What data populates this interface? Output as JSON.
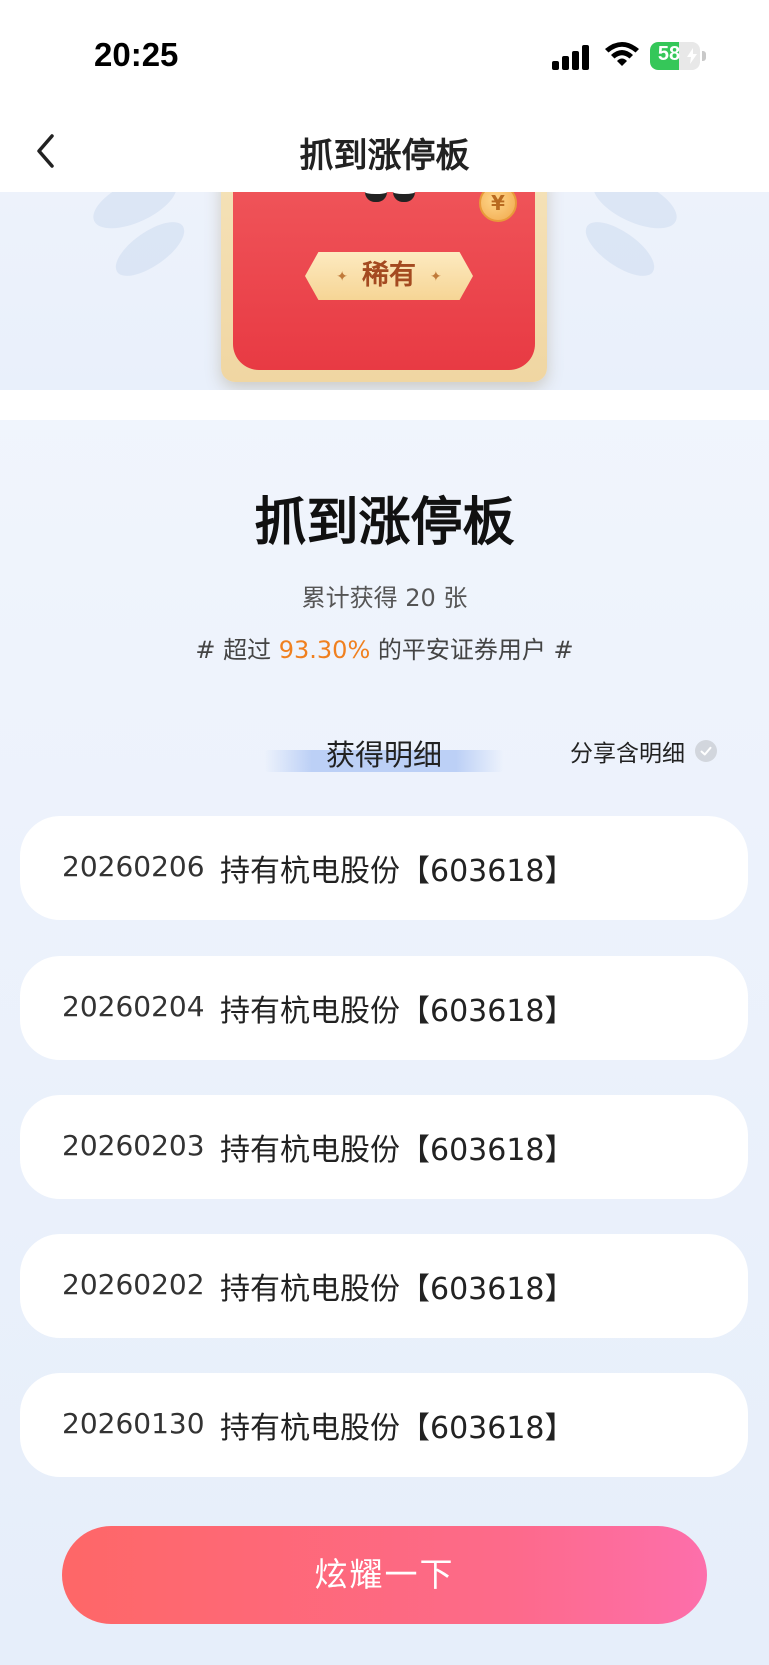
{
  "status_bar": {
    "time": "20:25",
    "battery": "58",
    "battery_level": 0.58
  },
  "nav": {
    "title": "抓到涨停板",
    "back_icon": "chevron-left-icon"
  },
  "card": {
    "badge": "稀有",
    "coin_symbol": "¥"
  },
  "summary": {
    "title": "抓到涨停板",
    "count_text": "累计获得 20 张",
    "rank_prefix": "# 超过 ",
    "rank_percent": "93.30%",
    "rank_suffix": " 的平安证券用户 #"
  },
  "detail": {
    "tab_label": "获得明细",
    "share_label": "分享含明细",
    "share_checked": false
  },
  "records": [
    {
      "date": "20260206",
      "desc": "持有杭电股份【603618】"
    },
    {
      "date": "20260204",
      "desc": "持有杭电股份【603618】"
    },
    {
      "date": "20260203",
      "desc": "持有杭电股份【603618】"
    },
    {
      "date": "20260202",
      "desc": "持有杭电股份【603618】"
    },
    {
      "date": "20260130",
      "desc": "持有杭电股份【603618】"
    }
  ],
  "action_button": "炫耀一下",
  "colors": {
    "accent_orange": "#f0801f",
    "button_start": "#fe6767",
    "button_end": "#fd6fab",
    "tab_underline": "#bcd0f6"
  }
}
